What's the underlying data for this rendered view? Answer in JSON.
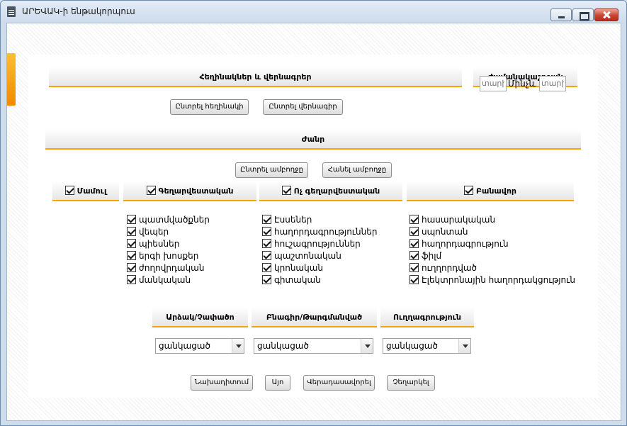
{
  "window": {
    "title": "ԱՐԵՎԱԿ-ի ենթակորպուս"
  },
  "sections": {
    "authors_titles": "Հեղինակներ և վերնագրեր",
    "time_period": "Ժամանակաշրջան",
    "genre": "Ժանր"
  },
  "buttons": {
    "choose_author": "Ընտրել հեղինակի",
    "choose_title": "Ընտրել վերնագիր",
    "select_all": "Ընտրել ամբողջը",
    "deselect_all": "Հանել ամբողջը",
    "preview": "Նախադիտում",
    "ok": "Այո",
    "reset": "Վերադասավորել",
    "cancel": "Չեղարկել"
  },
  "period": {
    "from_placeholder": "տարի",
    "until_label": "Մինչև",
    "to_placeholder": "տարի"
  },
  "genre_groups": {
    "press": "Մամուլ",
    "fiction": "Գեղարվեստական",
    "nonfiction": "Ոչ գեղարվեստական",
    "spoken": "Բանավոր"
  },
  "fiction_items": [
    "պատմվածքներ",
    "վեպեր",
    "պիեսներ",
    "երգի խոսքեր",
    "ժողովրդական",
    "մանկական"
  ],
  "nonfiction_items": [
    "Էսսեներ",
    "հաղորդագրություններ",
    "հուշագրություններ",
    "պաշտոնական",
    "կրոնական",
    "գիտական"
  ],
  "spoken_items": [
    "հասարակական",
    "սպոնտան",
    "հաղորդագրություն",
    "ֆիլմ",
    "ուղղորդված",
    "Էլեկտրոնային հաղորդակցություն"
  ],
  "filters": {
    "prose_verse": {
      "label": "Արձակ/Չափածո",
      "value": "ցանկացած"
    },
    "original_translated": {
      "label": "Բնագիր/Թարգմանված",
      "value": "ցանկացած"
    },
    "orthography": {
      "label": "Ուղղագրություն",
      "value": "ցանկացած"
    }
  }
}
